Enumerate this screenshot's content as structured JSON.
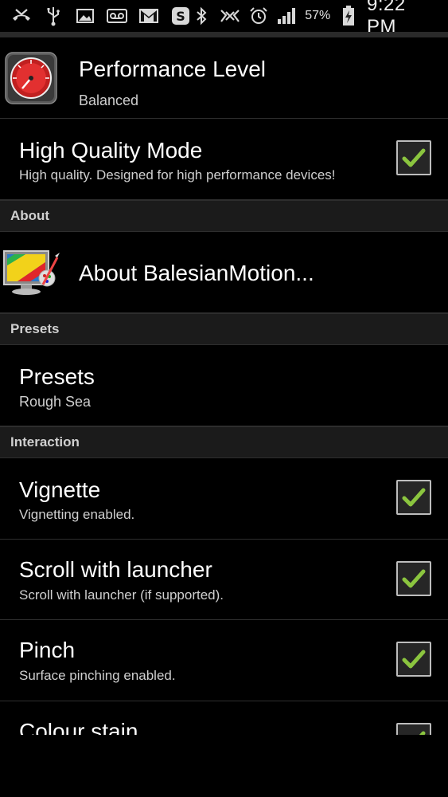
{
  "status_bar": {
    "battery_percent": "57%",
    "time": "9:22 PM"
  },
  "rows": {
    "performance": {
      "title": "Performance Level",
      "subtitle": "Balanced"
    },
    "high_quality": {
      "title": "High Quality Mode",
      "subtitle": "High quality. Designed for high performance devices!",
      "checked": true
    },
    "about_header": "About",
    "about": {
      "title": "About BalesianMotion..."
    },
    "presets_header": "Presets",
    "presets": {
      "title": "Presets",
      "subtitle": "Rough Sea"
    },
    "interaction_header": "Interaction",
    "vignette": {
      "title": "Vignette",
      "subtitle": "Vignetting enabled.",
      "checked": true
    },
    "scroll": {
      "title": "Scroll with launcher",
      "subtitle": "Scroll with launcher (if supported).",
      "checked": true
    },
    "pinch": {
      "title": "Pinch",
      "subtitle": "Surface pinching enabled.",
      "checked": true
    },
    "colour_stain": {
      "title": "Colour stain",
      "checked": true
    }
  },
  "colors": {
    "check_green": "#8bc53f",
    "header_bg": "#1b1b1b"
  }
}
